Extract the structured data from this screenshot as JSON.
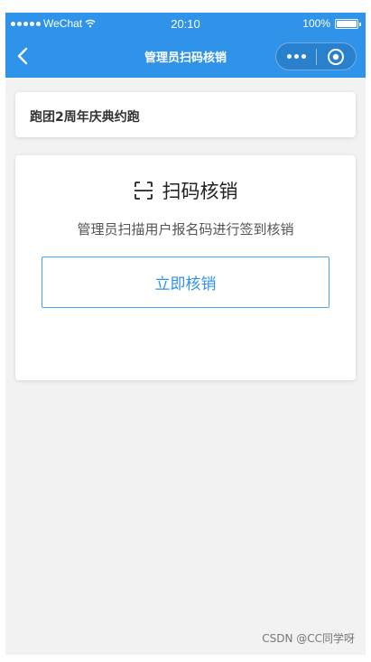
{
  "status_bar": {
    "carrier": "WeChat",
    "time": "20:10",
    "battery": "100%"
  },
  "nav": {
    "title": "管理员扫码核销"
  },
  "event": {
    "name": "跑团2周年庆典约跑"
  },
  "scan": {
    "title": "扫码核销",
    "description": "管理员扫描用户报名码进行签到核销",
    "button_label": "立即核销"
  },
  "footer": {
    "credit": "CSDN @CC同学呀"
  },
  "colors": {
    "nav_bg": "#2f93ea",
    "page_bg": "#f2f2f2",
    "accent": "#2f93ea"
  },
  "icons": {
    "back": "chevron-left-icon",
    "more": "more-dots-icon",
    "close": "target-circle-icon",
    "scan": "scan-frame-icon"
  }
}
